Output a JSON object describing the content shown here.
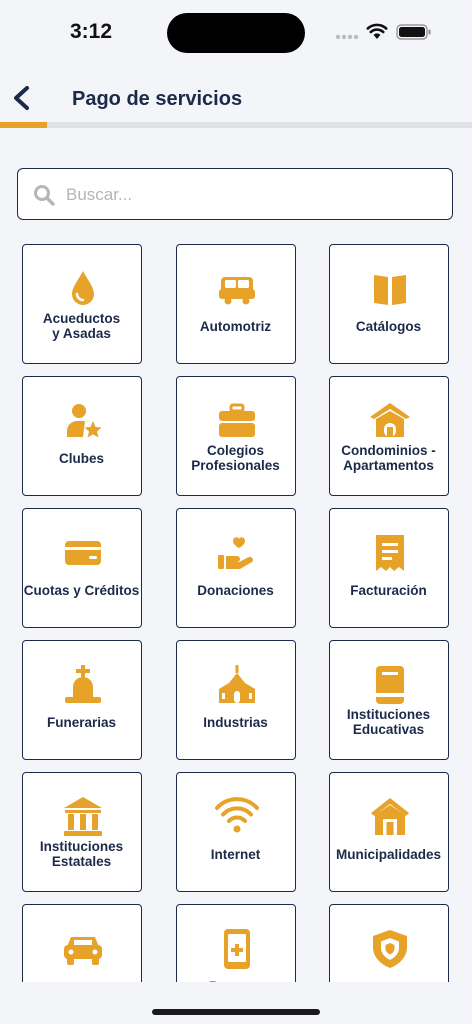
{
  "status_bar": {
    "time": "3:12"
  },
  "header": {
    "title": "Pago de servicios"
  },
  "progress": {
    "fraction": 0.1
  },
  "search": {
    "placeholder": "Buscar..."
  },
  "colors": {
    "accent": "#e6a229",
    "navy": "#1c2a4a",
    "background": "#f3f5f8"
  },
  "categories": [
    {
      "label": "Acueductos\ny Asadas",
      "icon": "water-drop-icon"
    },
    {
      "label": "Automotriz",
      "icon": "car-icon"
    },
    {
      "label": "Catálogos",
      "icon": "book-icon"
    },
    {
      "label": "Clubes",
      "icon": "user-star-icon"
    },
    {
      "label": "Colegios\nProfesionales",
      "icon": "briefcase-icon"
    },
    {
      "label": "Condominios -\nApartamentos",
      "icon": "house-icon"
    },
    {
      "label": "Cuotas y Créditos",
      "icon": "credit-card-icon"
    },
    {
      "label": "Donaciones",
      "icon": "hand-heart-icon"
    },
    {
      "label": "Facturación",
      "icon": "receipt-icon"
    },
    {
      "label": "Funerarias",
      "icon": "grave-icon"
    },
    {
      "label": "Industrias",
      "icon": "church-icon"
    },
    {
      "label": "Instituciones\nEducativas",
      "icon": "book-closed-icon"
    },
    {
      "label": "Instituciones\nEstatales",
      "icon": "bank-icon"
    },
    {
      "label": "Internet",
      "icon": "wifi-icon"
    },
    {
      "label": "Municipalidades",
      "icon": "building-icon"
    },
    {
      "label": "",
      "icon": "car-front-icon"
    },
    {
      "label": "Recarga",
      "icon": "phone-plus-icon"
    },
    {
      "label": "",
      "icon": "shield-icon"
    }
  ]
}
